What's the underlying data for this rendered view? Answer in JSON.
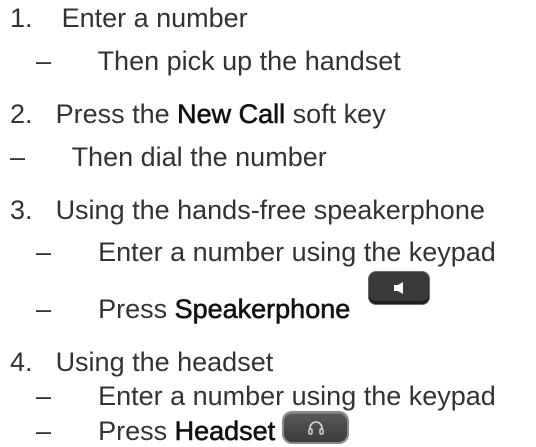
{
  "steps": [
    {
      "number": "1.",
      "label": "Enter a number",
      "sub": [
        "Then pick up the handset"
      ]
    },
    {
      "number": "2.",
      "label_pre": "Press the ",
      "label_bold": "New Call",
      "label_post": " soft key",
      "sub": [
        "Then dial the number"
      ]
    },
    {
      "number": "3.",
      "label": "Using the hands-free speakerphone",
      "sub": [
        "Enter a number using the keypad"
      ],
      "press_pre": "Press ",
      "press_bold": "Speakerphone"
    },
    {
      "number": "4.",
      "label": "Using the headset",
      "sub": [
        "Enter a number using the keypad"
      ],
      "press_pre": "Press ",
      "press_bold": "Headset"
    }
  ],
  "dash": "–",
  "icons": {
    "speakerphone": "speaker-icon",
    "headset": "headset-icon"
  },
  "colors": {
    "text": "#333333",
    "emphasis": "#111111",
    "key": "#3a3a3a"
  }
}
